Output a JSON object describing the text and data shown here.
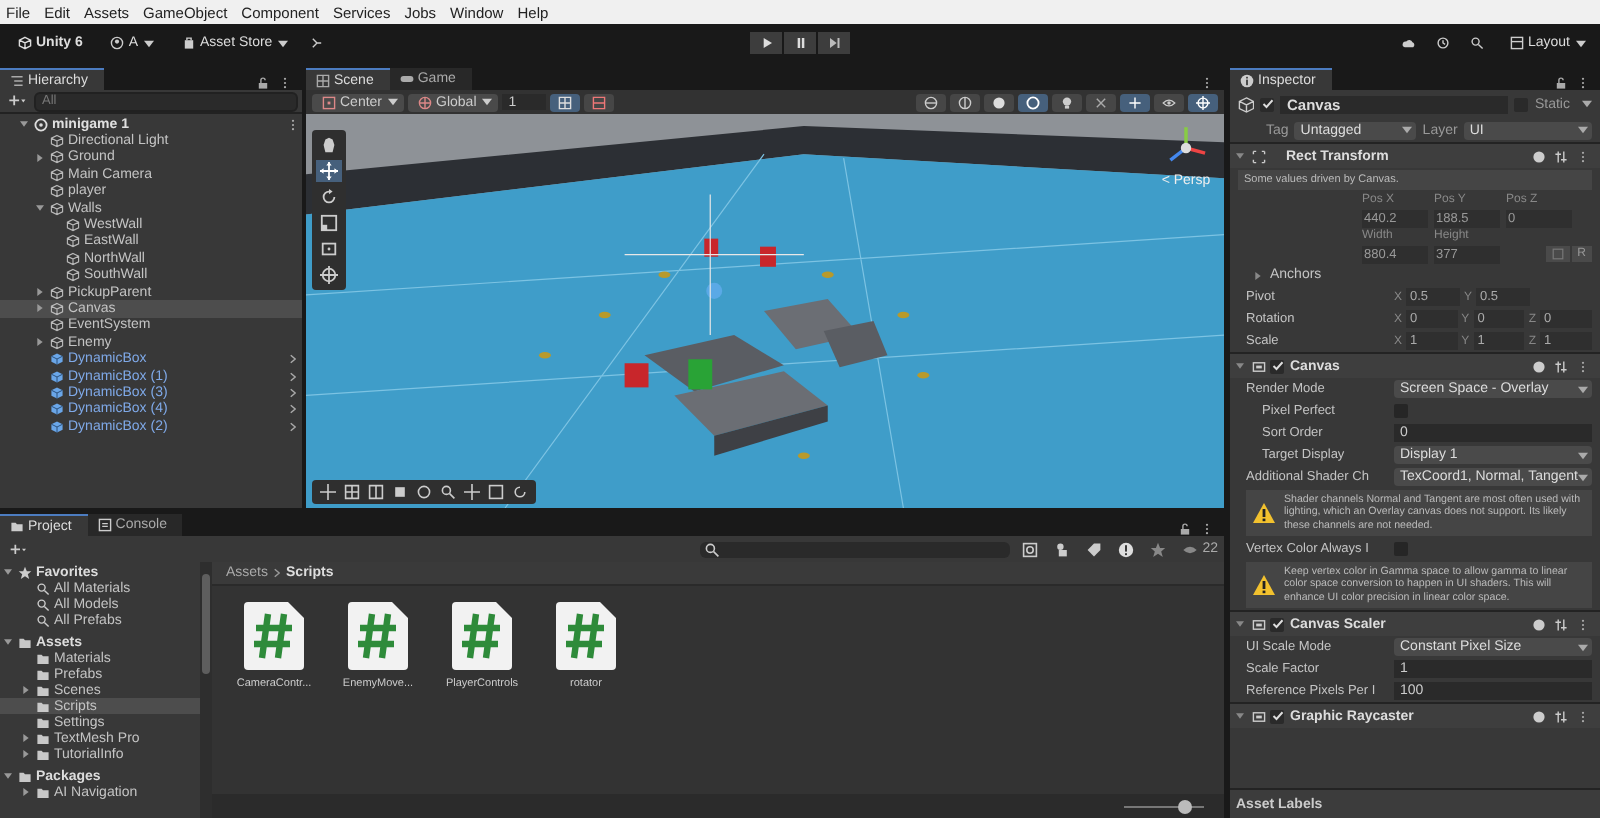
{
  "menu": [
    "File",
    "Edit",
    "Assets",
    "GameObject",
    "Component",
    "Services",
    "Jobs",
    "Window",
    "Help"
  ],
  "toolbar": {
    "product": "Unity 6",
    "account": "A",
    "store": "Asset Store",
    "layout": "Layout"
  },
  "hierarchy": {
    "title": "Hierarchy",
    "search_placeholder": "All",
    "items": [
      {
        "name": "minigame 1",
        "kind": "scene",
        "expanded": true,
        "selected": false,
        "children": [
          {
            "name": "Directional Light",
            "kind": "object",
            "selected": false
          },
          {
            "name": "Ground",
            "kind": "object",
            "expanded": false,
            "selected": false
          },
          {
            "name": "Main Camera",
            "kind": "object",
            "selected": false
          },
          {
            "name": "player",
            "kind": "object",
            "selected": false
          },
          {
            "name": "Walls",
            "kind": "object",
            "expanded": true,
            "selected": false,
            "children": [
              {
                "name": "WestWall",
                "kind": "object",
                "selected": false
              },
              {
                "name": "EastWall",
                "kind": "object",
                "selected": false
              },
              {
                "name": "NorthWall",
                "kind": "object",
                "selected": false
              },
              {
                "name": "SouthWall",
                "kind": "object",
                "selected": false
              }
            ]
          },
          {
            "name": "PickupParent",
            "kind": "object",
            "expanded": false,
            "selected": false
          },
          {
            "name": "Canvas",
            "kind": "object",
            "expanded": false,
            "selected": true
          },
          {
            "name": "EventSystem",
            "kind": "object",
            "selected": false
          },
          {
            "name": "Enemy",
            "kind": "object",
            "expanded": false,
            "selected": false
          },
          {
            "name": "DynamicBox",
            "kind": "prefab",
            "selected": false
          },
          {
            "name": "DynamicBox (1)",
            "kind": "prefab",
            "selected": false
          },
          {
            "name": "DynamicBox (3)",
            "kind": "prefab",
            "selected": false
          },
          {
            "name": "DynamicBox (4)",
            "kind": "prefab",
            "selected": false
          },
          {
            "name": "DynamicBox (2)",
            "kind": "prefab",
            "selected": false
          }
        ]
      }
    ]
  },
  "scene": {
    "tabs": [
      {
        "label": "Scene",
        "selected": true
      },
      {
        "label": "Game",
        "selected": false
      }
    ],
    "pivot": "Center",
    "space": "Global",
    "grid_size": "1",
    "projection": "< Persp"
  },
  "inspector": {
    "title": "Inspector",
    "object_name": "Canvas",
    "active": true,
    "static_label": "Static",
    "static": false,
    "tag_label": "Tag",
    "tag": "Untagged",
    "layer_label": "Layer",
    "layer": "UI",
    "rect_transform": {
      "title": "Rect Transform",
      "note": "Some values driven by Canvas.",
      "pos_labels": [
        "Pos X",
        "Pos Y",
        "Pos Z"
      ],
      "pos_values": [
        "440.2",
        "188.5",
        "0"
      ],
      "size_labels": [
        "Width",
        "Height"
      ],
      "size_values": [
        "880.4",
        "377"
      ],
      "raw_button": "R",
      "anchors": "Anchors",
      "vectors": [
        {
          "label": "Pivot",
          "values": [
            {
              "axis": "X",
              "value": "0.5"
            },
            {
              "axis": "Y",
              "value": "0.5"
            }
          ]
        },
        {
          "label": "Rotation",
          "values": [
            {
              "axis": "X",
              "value": "0"
            },
            {
              "axis": "Y",
              "value": "0"
            },
            {
              "axis": "Z",
              "value": "0"
            }
          ]
        },
        {
          "label": "Scale",
          "values": [
            {
              "axis": "X",
              "value": "1"
            },
            {
              "axis": "Y",
              "value": "1"
            },
            {
              "axis": "Z",
              "value": "1"
            }
          ]
        }
      ]
    },
    "components": [
      {
        "title": "Canvas",
        "enabled": true,
        "rows": [
          {
            "kind": "dropdown",
            "label": "Render Mode",
            "value": "Screen Space - Overlay",
            "children": [
              {
                "kind": "checkbox",
                "label": "Pixel Perfect",
                "checked": false
              },
              {
                "kind": "text",
                "label": "Sort Order",
                "value": "0"
              },
              {
                "kind": "dropdown",
                "label": "Target Display",
                "value": "Display 1"
              }
            ]
          },
          {
            "kind": "dropdown",
            "label": "Additional Shader Ch",
            "value": "TexCoord1, Normal, Tangent"
          },
          {
            "kind": "warning",
            "text": "Shader channels Normal and Tangent are most often used with lighting, which an Overlay canvas does not support. Its likely these channels are not needed."
          },
          {
            "kind": "checkbox",
            "label": "Vertex Color Always I",
            "checked": false
          },
          {
            "kind": "warning",
            "text": "Keep vertex color in Gamma space to allow gamma to linear color space conversion to happen in UI shaders. This will enhance UI color precision in linear color space."
          }
        ]
      },
      {
        "title": "Canvas Scaler",
        "enabled": true,
        "rows": [
          {
            "kind": "dropdown",
            "label": "UI Scale Mode",
            "value": "Constant Pixel Size"
          },
          {
            "kind": "text",
            "label": "Scale Factor",
            "value": "1"
          },
          {
            "kind": "text",
            "label": "Reference Pixels Per I",
            "value": "100"
          }
        ]
      },
      {
        "title": "Graphic Raycaster",
        "enabled": true
      }
    ],
    "asset_labels": "Asset Labels"
  },
  "project": {
    "tabs": [
      {
        "label": "Project",
        "selected": true
      },
      {
        "label": "Console",
        "selected": false
      }
    ],
    "count": "22",
    "tree": [
      {
        "name": "Favorites",
        "kind": "favorites",
        "expanded": true,
        "selected": false,
        "children": [
          {
            "name": "All Materials",
            "kind": "search",
            "selected": false
          },
          {
            "name": "All Models",
            "kind": "search",
            "selected": false
          },
          {
            "name": "All Prefabs",
            "kind": "search",
            "selected": false
          }
        ]
      },
      {
        "name": "Assets",
        "kind": "folder",
        "expanded": true,
        "selected": false,
        "children": [
          {
            "name": "Materials",
            "kind": "folder",
            "selected": false
          },
          {
            "name": "Prefabs",
            "kind": "folder",
            "selected": false
          },
          {
            "name": "Scenes",
            "kind": "folder",
            "expanded": false,
            "selected": false
          },
          {
            "name": "Scripts",
            "kind": "folder",
            "selected": true
          },
          {
            "name": "Settings",
            "kind": "folder",
            "selected": false
          },
          {
            "name": "TextMesh Pro",
            "kind": "folder",
            "expanded": false,
            "selected": false
          },
          {
            "name": "TutorialInfo",
            "kind": "folder",
            "expanded": false,
            "selected": false
          }
        ]
      },
      {
        "name": "Packages",
        "kind": "folder",
        "expanded": true,
        "selected": false,
        "children": [
          {
            "name": "AI Navigation",
            "kind": "folder",
            "expanded": false,
            "selected": false
          }
        ]
      }
    ],
    "breadcrumb": [
      "Assets",
      "Scripts"
    ],
    "files": [
      {
        "name": "CameraContr..."
      },
      {
        "name": "EnemyMove..."
      },
      {
        "name": "PlayerControls"
      },
      {
        "name": "rotator"
      }
    ],
    "zoom": {
      "level": 0.75
    }
  }
}
